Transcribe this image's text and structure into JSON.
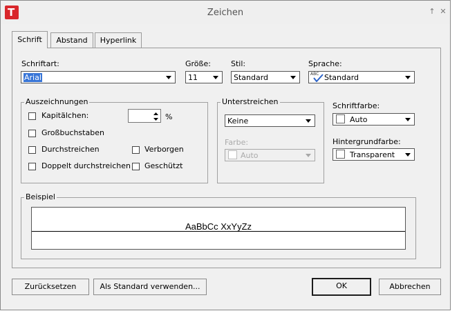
{
  "window": {
    "title": "Zeichen",
    "app_icon_letter": "T"
  },
  "tabs": [
    {
      "label": "Schrift",
      "active": true
    },
    {
      "label": "Abstand",
      "active": false
    },
    {
      "label": "Hyperlink",
      "active": false
    }
  ],
  "font": {
    "label": "Schriftart:",
    "value": "Arial"
  },
  "size": {
    "label": "Größe:",
    "value": "11"
  },
  "style": {
    "label": "Stil:",
    "value": "Standard"
  },
  "language": {
    "label": "Sprache:",
    "value": "Standard",
    "icon_text": "ABC"
  },
  "decorations": {
    "title": "Auszeichnungen",
    "kapitaelchen": "Kapitälchen:",
    "kapitaelchen_percent": "%",
    "grossbuchstaben": "Großbuchstaben",
    "durchstreichen": "Durchstreichen",
    "verborgen": "Verborgen",
    "doppelt": "Doppelt durchstreichen",
    "geschuetzt": "Geschützt"
  },
  "underline": {
    "title": "Unterstreichen",
    "value": "Keine",
    "color_label": "Farbe:",
    "color_value": "Auto"
  },
  "font_color": {
    "label": "Schriftfarbe:",
    "value": "Auto"
  },
  "background_color": {
    "label": "Hintergrundfarbe:",
    "value": "Transparent"
  },
  "preview": {
    "title": "Beispiel",
    "sample_text": "AaBbCc XxYyZz"
  },
  "buttons": {
    "reset": "Zurücksetzen",
    "set_default": "Als Standard verwenden...",
    "ok": "OK",
    "cancel": "Abbrechen"
  },
  "colors": {
    "app_icon": "#d9262b",
    "selection": "#3875d7",
    "background": "#f0f0f0"
  }
}
